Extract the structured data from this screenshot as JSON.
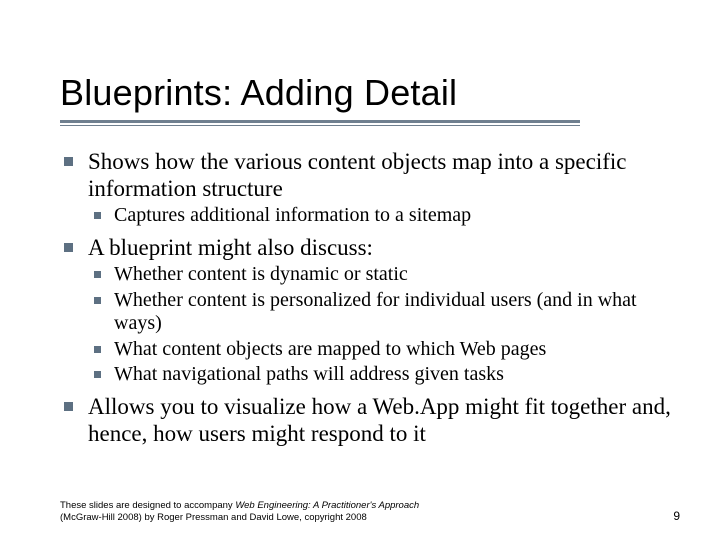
{
  "title": "Blueprints: Adding Detail",
  "bullets": [
    {
      "text": "Shows how the various content objects map into a specific information structure",
      "sub": [
        "Captures additional information to a sitemap"
      ]
    },
    {
      "text": "A blueprint might also discuss:",
      "sub": [
        "Whether content is dynamic or static",
        "Whether content is personalized for individual users (and in what ways)",
        "What content objects are mapped to which Web pages",
        "What navigational paths will address given tasks"
      ]
    },
    {
      "text": "Allows you to visualize how a Web.App might fit together and, hence, how users might respond to it",
      "sub": []
    }
  ],
  "footer": {
    "line1_a": "These slides are designed to accompany ",
    "line1_b": "Web Engineering: A Practitioner's Approach",
    "line2": "(McGraw-Hill 2008) by Roger Pressman and David Lowe, copyright 2008"
  },
  "page_number": "9"
}
